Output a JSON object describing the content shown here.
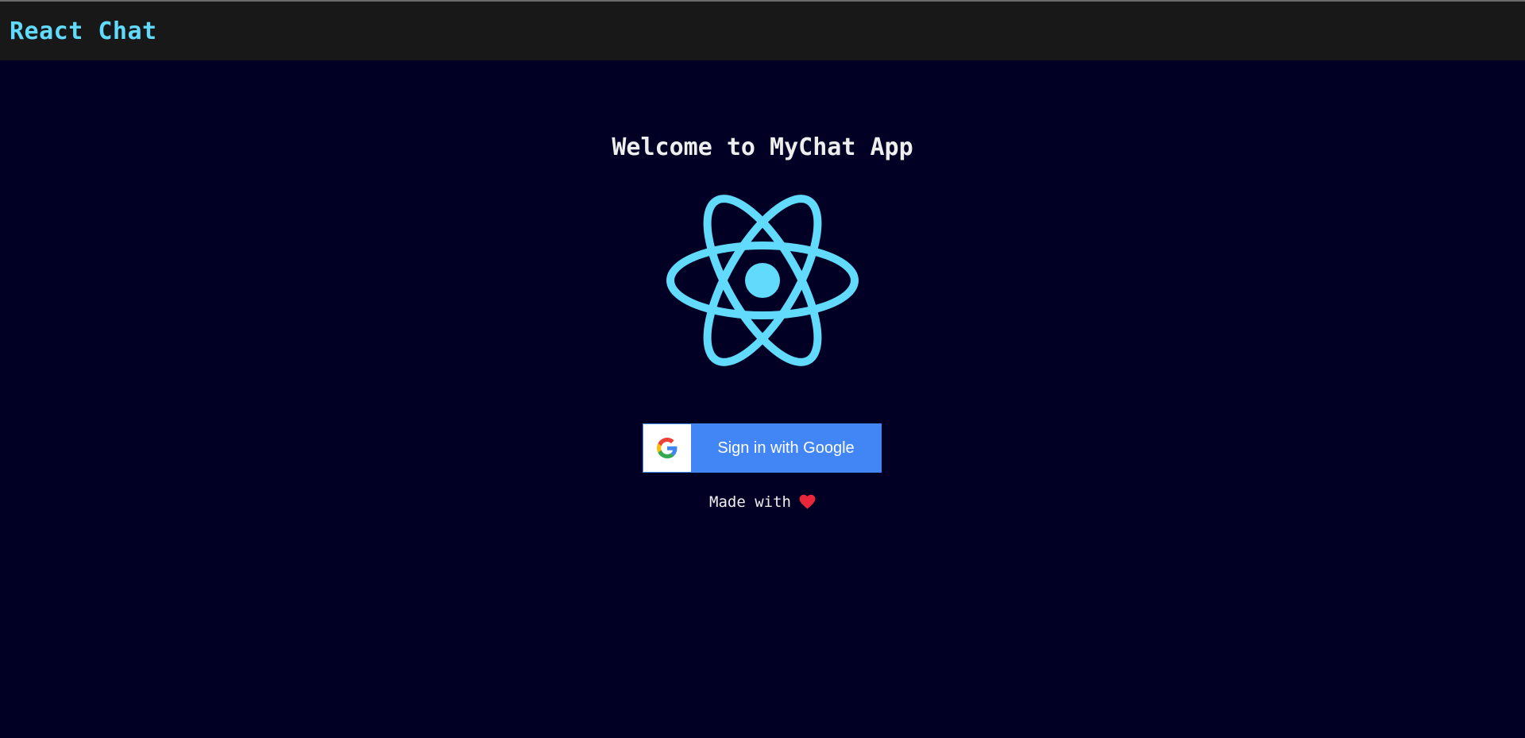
{
  "navbar": {
    "brand": "React Chat"
  },
  "main": {
    "welcome_title": "Welcome to MyChat App",
    "logo_icon": "react-atom-icon",
    "signin_button_label": "Sign in with Google",
    "signin_icon": "google-g-icon",
    "footer_text": "Made with",
    "footer_icon": "heart-icon"
  },
  "colors": {
    "background": "#010024",
    "navbar_background": "#181818",
    "accent": "#61dafb",
    "google_blue": "#4285f4",
    "heart": "#e8283a"
  }
}
